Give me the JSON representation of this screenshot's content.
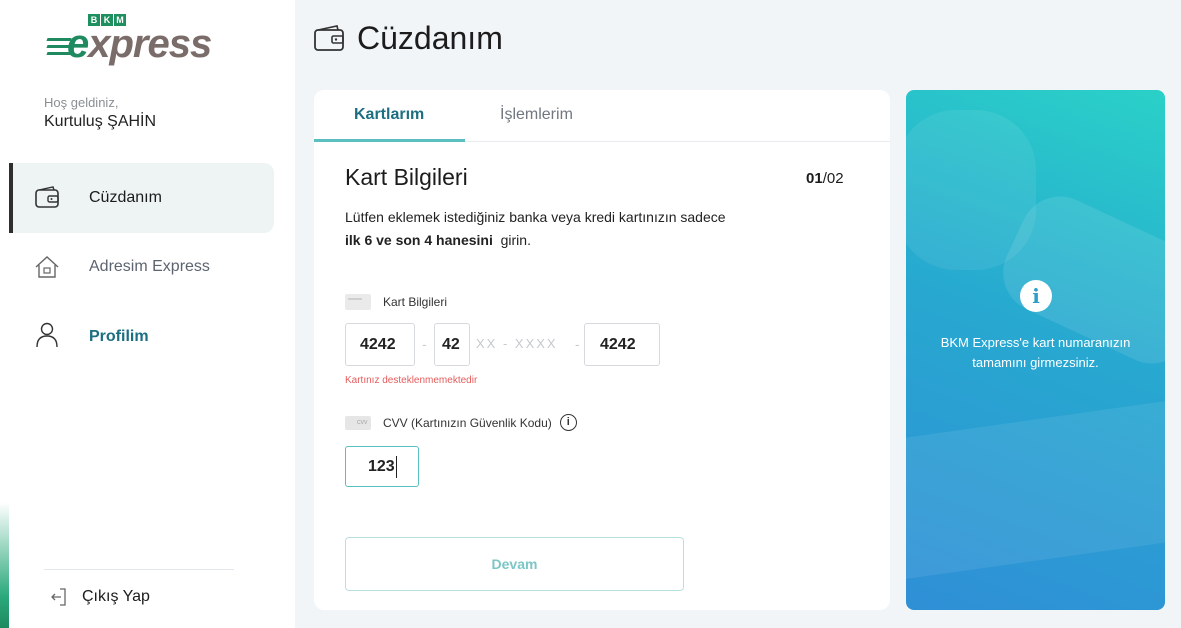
{
  "brand": {
    "logo_top": "BKM",
    "logo_text_e": "e",
    "logo_text_rest": "xpress"
  },
  "user": {
    "greeting": "Hoş geldiniz,",
    "name": "Kurtuluş ŞAHİN"
  },
  "sidebar": {
    "items": [
      {
        "label": "Cüzdanım",
        "icon": "wallet-icon",
        "active": true
      },
      {
        "label": "Adresim Express",
        "icon": "home-icon",
        "active": false
      },
      {
        "label": "Profilim",
        "icon": "user-icon",
        "active": false
      }
    ],
    "logout_label": "Çıkış Yap"
  },
  "header": {
    "title": "Cüzdanım"
  },
  "tabs": [
    {
      "label": "Kartlarım",
      "active": true
    },
    {
      "label": "İşlemlerim",
      "active": false
    }
  ],
  "form": {
    "title": "Kart Bilgileri",
    "step_current": "01",
    "step_total": "/02",
    "desc_line1": "Lütfen eklemek istediğiniz banka veya kredi kartınızın sadece",
    "desc_bold": "ilk 6 ve son 4 hanesini",
    "desc_tail": "girin.",
    "card_label": "Kart Bilgileri",
    "card_first4": "4242",
    "card_next2": "42",
    "card_masked": "XX - XXXX",
    "card_last4": "4242",
    "separator": "-",
    "error": "Kartınız desteklenmemektedir",
    "cvv_label": "CVV (Kartınızın Güvenlik Kodu)",
    "cvv_info_glyph": "i",
    "cvv_value": "123",
    "cvv_mini": "CVV",
    "continue_label": "Devam"
  },
  "info_panel": {
    "icon_glyph": "i",
    "message": "BKM Express'e kart numaranızın tamamını girmezsiniz."
  },
  "colors": {
    "brand_green": "#1f8a60",
    "teal": "#1b6f80",
    "accent": "#5bbfbf",
    "error": "#e45c5c"
  }
}
